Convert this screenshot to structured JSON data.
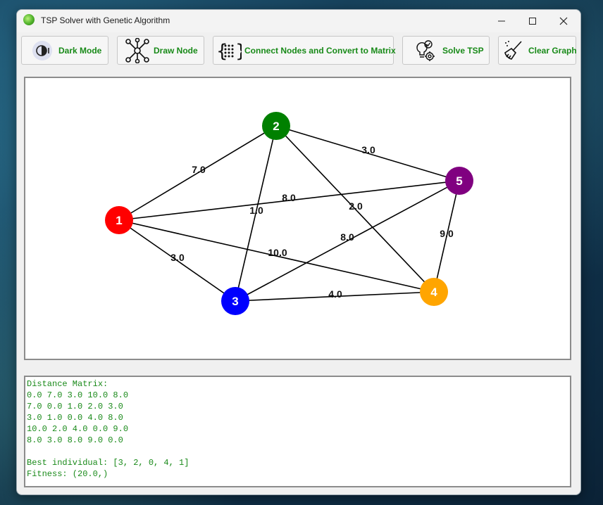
{
  "window": {
    "title": "TSP Solver with Genetic Algorithm",
    "min_symbol": "—",
    "max_symbol": "☐",
    "close_symbol": "✕"
  },
  "toolbar": {
    "dark_mode": "Dark Mode",
    "draw_node": "Draw Node",
    "connect": "Connect Nodes and Convert to Matrix",
    "solve": "Solve TSP",
    "clear": "Clear Graph"
  },
  "graph": {
    "nodes": [
      {
        "label": "1",
        "color": "#ff0000"
      },
      {
        "label": "2",
        "color": "#008000"
      },
      {
        "label": "3",
        "color": "#0000ff"
      },
      {
        "label": "4",
        "color": "#ffa500"
      },
      {
        "label": "5",
        "color": "#800080"
      }
    ],
    "edges": [
      {
        "a": 0,
        "b": 1,
        "weight": "7.0"
      },
      {
        "a": 0,
        "b": 2,
        "weight": "3.0"
      },
      {
        "a": 0,
        "b": 3,
        "weight": "10.0"
      },
      {
        "a": 0,
        "b": 4,
        "weight": "8.0"
      },
      {
        "a": 1,
        "b": 2,
        "weight": "1.0"
      },
      {
        "a": 1,
        "b": 3,
        "weight": "2.0"
      },
      {
        "a": 1,
        "b": 4,
        "weight": "3.0"
      },
      {
        "a": 2,
        "b": 3,
        "weight": "4.0"
      },
      {
        "a": 2,
        "b": 4,
        "weight": "8.0"
      },
      {
        "a": 3,
        "b": 4,
        "weight": "9.0"
      }
    ]
  },
  "output": {
    "heading": "Distance Matrix:",
    "matrix_rows": [
      "0.0 7.0 3.0 10.0 8.0",
      "7.0 0.0 1.0 2.0 3.0",
      "3.0 1.0 0.0 4.0 8.0",
      "10.0 2.0 4.0 0.0 9.0",
      "8.0 3.0 8.0 9.0 0.0"
    ],
    "best_individual": "Best individual: [3, 2, 0, 4, 1]",
    "fitness": "Fitness: (20.0,)"
  }
}
